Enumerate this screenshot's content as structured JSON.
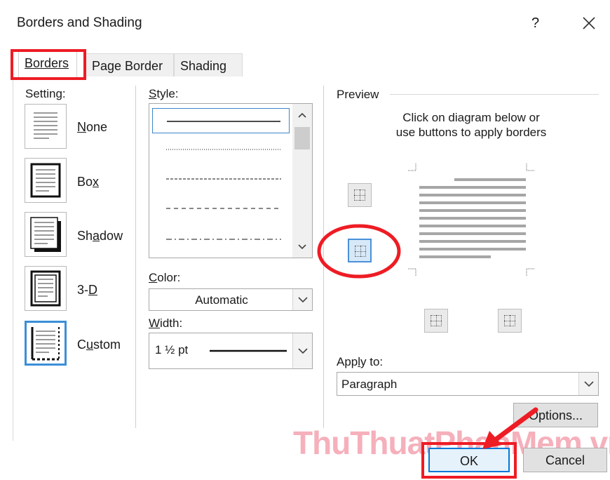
{
  "window": {
    "title": "Borders and Shading",
    "help": "?",
    "close": "✕"
  },
  "tabs": [
    {
      "label": "Borders",
      "active": true
    },
    {
      "label": "Page Border",
      "active": false
    },
    {
      "label": "Shading",
      "active": false
    }
  ],
  "setting": {
    "label": "Setting:",
    "items": [
      {
        "label": "None"
      },
      {
        "label": "Box"
      },
      {
        "label": "Shadow"
      },
      {
        "label": "3-D"
      },
      {
        "label": "Custom",
        "selected": true
      }
    ]
  },
  "style": {
    "label": "Style:"
  },
  "color": {
    "label": "Color:",
    "value": "Automatic"
  },
  "width": {
    "label": "Width:",
    "value": "1 ½ pt"
  },
  "preview": {
    "label": "Preview",
    "instructions_1": "Click on diagram below or",
    "instructions_2": "use buttons to apply borders"
  },
  "apply_to": {
    "label": "Apply to:",
    "value": "Paragraph"
  },
  "buttons": {
    "options": "Options...",
    "ok": "OK",
    "cancel": "Cancel"
  },
  "watermark": "ThuThuatPhanMem.vn",
  "colors": {
    "highlight": "#ee1c24",
    "selection": "#3a8ed8",
    "watermark": "#e85069"
  }
}
